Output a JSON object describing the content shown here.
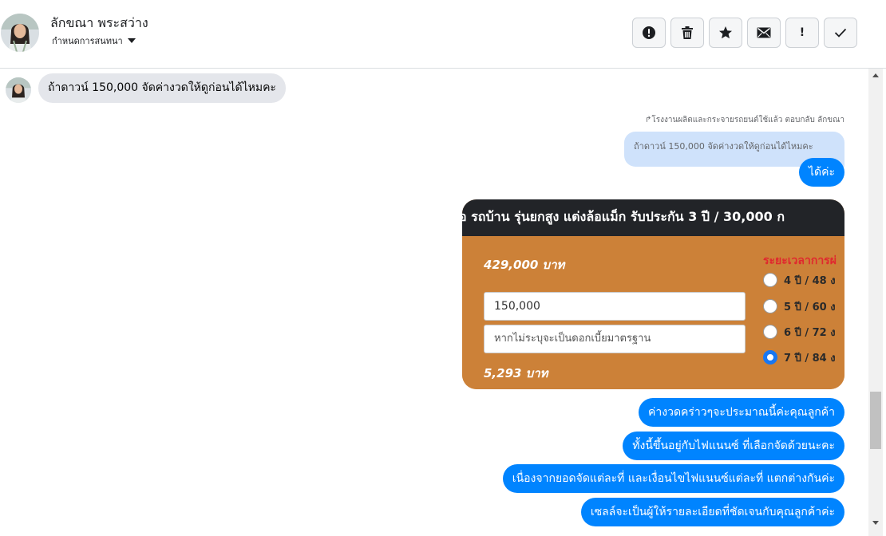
{
  "header": {
    "contact_name": "ลักขณา พระสว่าง",
    "conversation_settings": "กำหนดการสนทนา",
    "toolbar": [
      {
        "name": "spam-button",
        "icon": "alert-circle-icon"
      },
      {
        "name": "delete-button",
        "icon": "trash-icon"
      },
      {
        "name": "star-button",
        "icon": "star-icon"
      },
      {
        "name": "mark-unread-button",
        "icon": "envelope-icon"
      },
      {
        "name": "important-button",
        "icon": "exclamation-icon"
      },
      {
        "name": "done-button",
        "icon": "checkmark-icon"
      }
    ]
  },
  "messages": {
    "incoming_text": "ถ้าดาวน์ 150,000 จัดค่างวดให้ดูก่อนได้ไหมคะ",
    "reply_note": "↱โรงงานผลิตและกระจายรถยนต์ใช้แล้ว ตอบกลับ ลักขณา",
    "quoted_text": "ถ้าดาวน์ 150,000 จัดค่างวดให้ดูก่อนได้ไหมคะ",
    "reply_short": "ได้ค่ะ",
    "card": {
      "banner": "อ รถบ้าน รุ่นยกสูง แต่งล้อแม็ก รับประกัน 3 ปี / 30,000 ก",
      "price": "429,000 บาท",
      "down_payment_value": "150,000",
      "interest_placeholder": "หากไม่ระบุจะเป็นดอกเบี้ยมาตรฐาน",
      "monthly_payment": "5,293 บาท",
      "period_title": "ระยะเวลาการผ่",
      "period_options": [
        {
          "label": "4 ปี / 48 ง",
          "checked": false
        },
        {
          "label": "5 ปี / 60 ง",
          "checked": false
        },
        {
          "label": "6 ปี / 72 ง",
          "checked": false
        },
        {
          "label": "7 ปี / 84 ง",
          "checked": true
        }
      ]
    },
    "outgoing": [
      "ค่างวดคร่าวๆจะประมาณนี้ค่ะคุณลูกค้า",
      "ทั้งนี้ขึ้นอยู่กับไฟแนนซ์ ที่เลือกจัดด้วยนะคะ",
      "เนื่องจากยอดจัดแต่ละที่ และเงื่อนไขไฟแนนซ์แต่ละที่ แตกต่างกันค่ะ",
      "เซลล์จะเป็นผู้ให้รายละเอียดที่ชัดเจนกับคุณลูกค้าค่ะ"
    ]
  },
  "colors": {
    "outgoing_bubble": "#0084ff",
    "incoming_bubble": "#e4e6eb",
    "quoted_bubble": "#cfe2fb",
    "card_bg": "#cc8138",
    "card_banner": "#222428",
    "period_title": "#e0282e"
  }
}
